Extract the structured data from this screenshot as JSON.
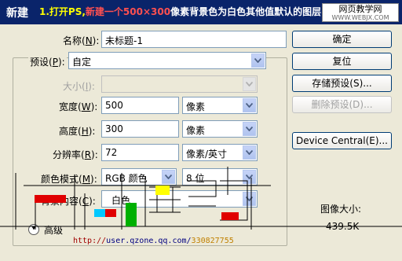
{
  "window": {
    "title": "新建"
  },
  "banner": {
    "part1": "1.打开PS,",
    "part2": "新建一个500×300",
    "part3": "像素背景色为白色其他值默认的图层"
  },
  "watermark": {
    "line1": "网页教学网",
    "line2": "WWW.WEBJX.COM"
  },
  "form": {
    "name": {
      "label": "名称(",
      "key": "N",
      "suffix": "):",
      "value": "未标题-1"
    },
    "preset": {
      "label": "预设(",
      "key": "P",
      "suffix": "):",
      "value": "自定"
    },
    "size": {
      "label": "大小(",
      "key": "I",
      "suffix": "):",
      "value": ""
    },
    "width": {
      "label": "宽度(",
      "key": "W",
      "suffix": "):",
      "value": "500",
      "unit": "像素"
    },
    "height": {
      "label": "高度(",
      "key": "H",
      "suffix": "):",
      "value": "300",
      "unit": "像素"
    },
    "resolution": {
      "label": "分辨率(",
      "key": "R",
      "suffix": "):",
      "value": "72",
      "unit": "像素/英寸"
    },
    "color_mode": {
      "label": "颜色模式(",
      "key": "M",
      "suffix": "):",
      "value": "RGB 颜色",
      "depth": "8 位"
    },
    "background": {
      "label": "背景内容(",
      "key": "C",
      "suffix": "):",
      "value": "白色"
    },
    "advanced": {
      "label": "高级"
    }
  },
  "buttons": {
    "ok": "确定",
    "reset": "复位",
    "save_preset": "存储预设(S)...",
    "delete_preset": "删除预设(D)...",
    "device_central": "Device Central(E)..."
  },
  "image_size": {
    "label": "图像大小:",
    "value": "439.5K"
  },
  "footer": {
    "url_a": "http://",
    "url_b": "user.qzone.qq.com",
    "url_c": "/",
    "url_d": "330827755"
  },
  "colors": {
    "titlebar": "#0a246a",
    "dialog_bg": "#ece9d8",
    "overlay_red": "#e00000",
    "overlay_green": "#00b000",
    "overlay_yellow": "#ffff00",
    "overlay_cyan": "#00c8ff"
  }
}
